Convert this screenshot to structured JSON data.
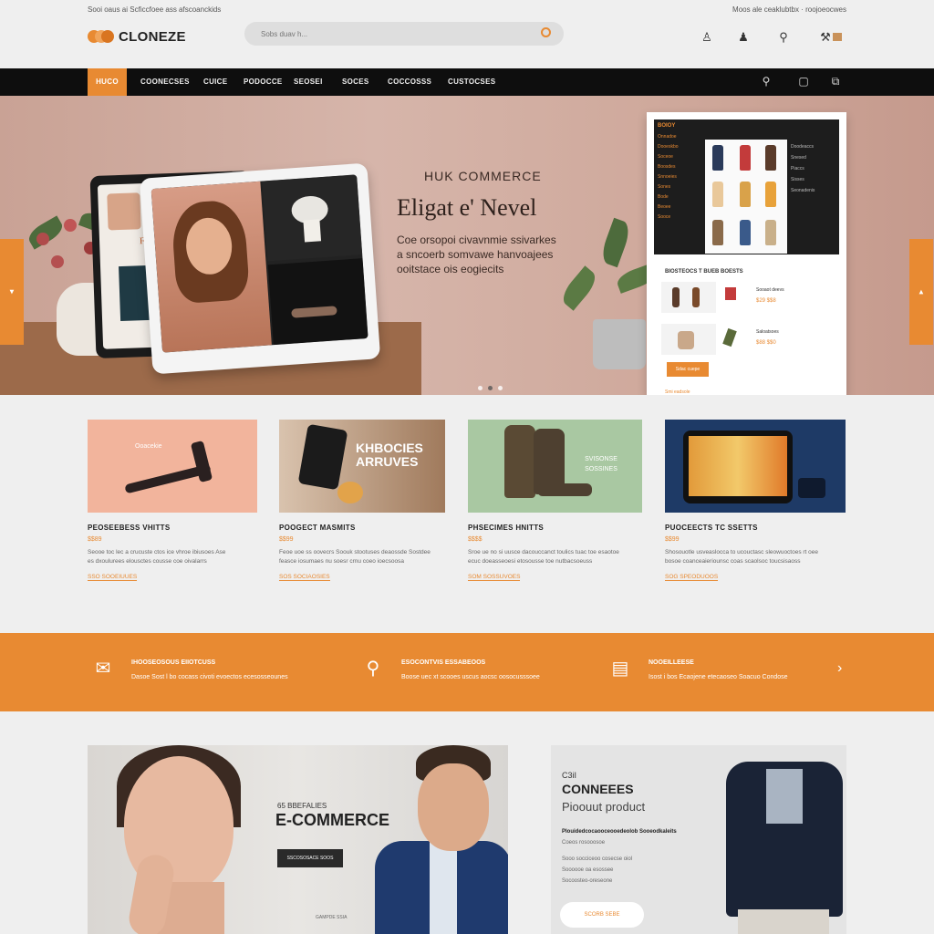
{
  "topbar": {
    "left_text": "Sooi oaus ai Scficcfoee ass afscoanckids",
    "right_text": "Moos ale ceaklubtbx · roojoeocwes"
  },
  "header": {
    "logo": "CLONEZE",
    "search_placeholder": "Sobs duav h..."
  },
  "header_icons": [
    "user-icon",
    "account-icon",
    "search-icon",
    "cart-icon"
  ],
  "nav": {
    "items": [
      "HUCO",
      "COONECSES",
      "CUICE",
      "PODOCCE",
      "SEOSEI",
      "SOCES",
      "COCCOSSS",
      "CUSTOCSES"
    ]
  },
  "hero": {
    "kicker": "HUK COMMERCE",
    "title": "Eligat e' Nevel",
    "subtitle": [
      "Coe orsopoi civavnmie ssivarkes",
      "a sncoerb somvawe hanvoajees",
      "ooitstace ois eogiecits"
    ],
    "tablet_back_text": "Fom",
    "shop_panel": {
      "header": "BOIOY",
      "sidebar": [
        "Onnadoe",
        "Dooeskbo",
        "Soceoe",
        "Boosdes",
        "Snnoeies",
        "Sones",
        "Bode",
        "Beoee",
        "Sooce"
      ],
      "filters": [
        "Doodeaccs",
        "Snesed",
        "Piaccs",
        "Sisses",
        "Seonadenis"
      ],
      "section_title": "BIOSTEOCS T BUEB BOESTS",
      "items": [
        {
          "name": "Sooaot deevs",
          "price": "$29 $$8"
        },
        {
          "name": "Saloatsoes",
          "price": "$88 $$0"
        }
      ],
      "button": "Sdac cuepe",
      "footer": "Smi eadsole"
    }
  },
  "cards": [
    {
      "img_text": "Ooacekie",
      "title": "PEOSEEBESS VHITTS",
      "price": "$$89",
      "desc": [
        "Seooe toc lec a crucuste ctos ice vhroe ibiusoes Ase",
        "es dxoulurees elousctes cousse coe oivalarrs"
      ],
      "link": "SSO SOOEIUUES"
    },
    {
      "img_text": "KHBOCIES ARRUVES",
      "title": "POOGECT MASMITS",
      "price": "$$99",
      "desc": [
        "Feoe uoe ss oovecrs Soouk stootuses deaossde Sostdee",
        "feasce iosumaes nu soesr crnu coeo ioecsoosa"
      ],
      "link": "SOS SOCIAOSIES"
    },
    {
      "img_text": "SVISONSE SOSSINES",
      "title": "PHSECIMES HNITTS",
      "price": "$$$$",
      "desc": [
        "Sroe ue no si uusce dacouccanct toulics tuac toe esaotoe",
        "ecuc doeasseoesi etosousse toe nutbacsoeuss"
      ],
      "link": "SOM SOSSUVOES"
    },
    {
      "img_text": "",
      "title": "PUOCEECTS TC SSETTS",
      "price": "$$99",
      "desc": [
        "Shosouotle usveaslocca to ucouctasc sleowuoctoes rt oee",
        "bosoe coanceaieriounsc coas scaolsoc toucsisaoss"
      ],
      "link": "SOG SPEODUOOS"
    }
  ],
  "features": [
    {
      "icon": "chat-icon",
      "title": "IHOOSEOSOUS EIIOTCUSS",
      "desc": "Dasoe Sost l bo cocass civoti evoectos ecesosseounes"
    },
    {
      "icon": "location-icon",
      "title": "ESOCONTVIS ESSABEOOS",
      "desc": "Boose uec xt scooes uscus aocsc oosocusssoee"
    },
    {
      "icon": "calendar-icon",
      "title": "NOOEILLEESE",
      "desc": "Isost i bos Ecaojene etecaoseo Soacuo Condose"
    }
  ],
  "promo_left": {
    "kicker": "65 BBEFALIES",
    "title": "E-COMMERCE",
    "button": "SSCOSOSACE SOOS",
    "footer": "GAMPDE SSIA"
  },
  "promo_right": {
    "kicker": "C3iI",
    "title": "CONNEEES",
    "subtitle": "Pioouut product",
    "line1": "Plouidedcocaooceooedeolob Sooeodkaleits",
    "lines": [
      "Coeos rosooosoe",
      "Sooo socciceoo cosecse oiol",
      "Soooooe oa esossee",
      "Socoosteo-oreseone"
    ],
    "button": "SCORB SEBE"
  },
  "colors": {
    "accent": "#e88a32",
    "nav_bg": "#0e0e0e",
    "page_bg": "#efefef"
  }
}
